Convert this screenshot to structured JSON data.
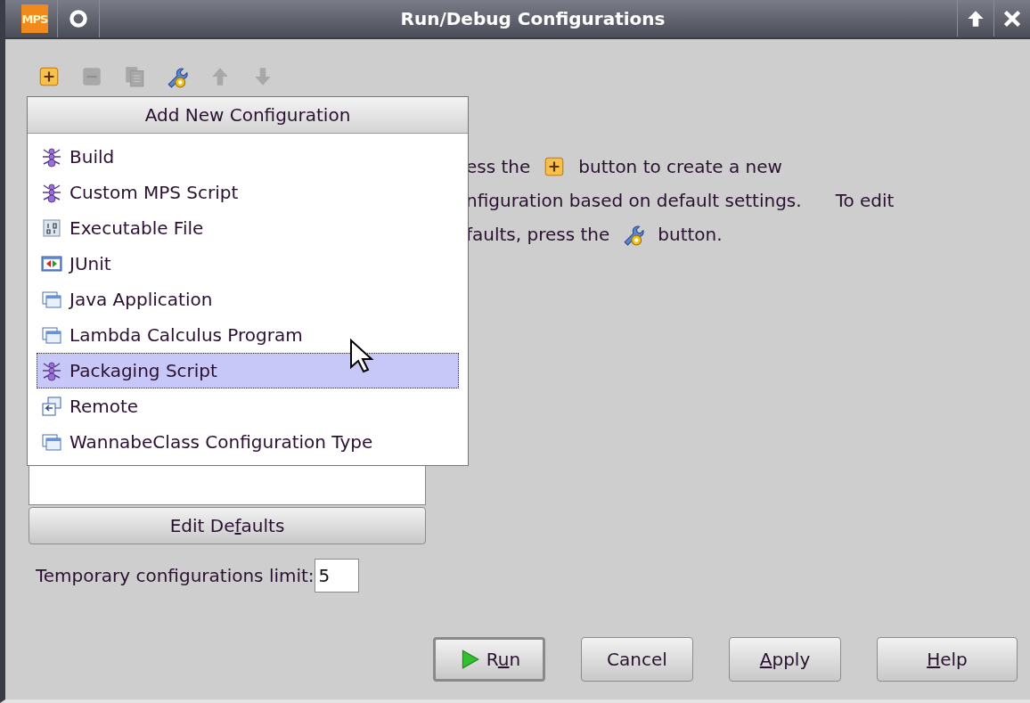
{
  "window": {
    "logo": "MPS",
    "title": "Run/Debug Configurations"
  },
  "toolbar": [
    {
      "kind": "add",
      "disabled": false
    },
    {
      "kind": "remove",
      "disabled": true
    },
    {
      "kind": "copy",
      "disabled": true
    },
    {
      "kind": "defaults",
      "disabled": false
    },
    {
      "kind": "up",
      "disabled": true
    },
    {
      "kind": "down",
      "disabled": true
    }
  ],
  "add_menu": {
    "title": "Add New Configuration",
    "items": [
      {
        "label": "Build",
        "kind": "ant",
        "selected": false
      },
      {
        "label": "Custom MPS Script",
        "kind": "ant",
        "selected": false
      },
      {
        "label": "Executable File",
        "kind": "exe",
        "selected": false
      },
      {
        "label": "JUnit",
        "kind": "junit",
        "selected": false
      },
      {
        "label": "Java Application",
        "kind": "app",
        "selected": false
      },
      {
        "label": "Lambda Calculus Program",
        "kind": "app",
        "selected": false
      },
      {
        "label": "Packaging Script",
        "kind": "ant",
        "selected": true
      },
      {
        "label": "Remote",
        "kind": "remote",
        "selected": false
      },
      {
        "label": "WannabeClass Configuration Type",
        "kind": "app",
        "selected": false
      }
    ]
  },
  "hint": [
    [
      {
        "kind": "text",
        "text": "ess the"
      },
      {
        "kind": "add"
      },
      {
        "kind": "text",
        "text": "button to create a new"
      }
    ],
    [
      {
        "kind": "text",
        "text": "nfiguration based on default settings."
      },
      {
        "kind": "text",
        "text": "To edit"
      }
    ],
    [
      {
        "kind": "text",
        "text": "faults, press the"
      },
      {
        "kind": "defaults"
      },
      {
        "kind": "text",
        "text": "button."
      }
    ]
  ],
  "edit_defaults": {
    "label": [
      {
        "text": "Edit De",
        "underline": false
      },
      {
        "text": "f",
        "underline": true
      },
      {
        "text": "aults",
        "underline": false
      }
    ]
  },
  "temp_limit": {
    "label": "Temporary configurations limit:",
    "value": "5"
  },
  "buttons": [
    {
      "label": [
        {
          "text": "R",
          "underline": false
        },
        {
          "text": "u",
          "underline": true
        },
        {
          "text": "n",
          "underline": false
        }
      ],
      "kind": "run",
      "default": true
    },
    {
      "label": [
        {
          "text": "Cancel",
          "underline": false
        }
      ],
      "kind": "plain",
      "default": false
    },
    {
      "label": [
        {
          "text": "A",
          "underline": true
        },
        {
          "text": "pply",
          "underline": false
        }
      ],
      "kind": "plain",
      "default": false
    },
    {
      "label": [
        {
          "text": "H",
          "underline": true
        },
        {
          "text": "elp",
          "underline": false
        }
      ],
      "kind": "plain",
      "default": false
    }
  ]
}
